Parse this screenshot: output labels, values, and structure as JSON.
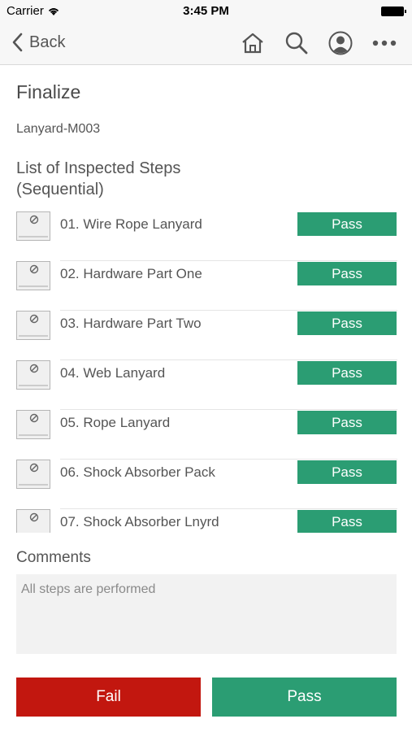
{
  "status": {
    "carrier": "Carrier",
    "time": "3:45 PM"
  },
  "nav": {
    "back_label": "Back",
    "icons": [
      "home-icon",
      "search-icon",
      "profile-icon",
      "more-icon"
    ]
  },
  "page": {
    "title": "Finalize",
    "asset": "Lanyard-M003",
    "list_title_line1": "List of Inspected Steps",
    "list_title_line2": "(Sequential)"
  },
  "steps": [
    {
      "name": "01. Wire Rope Lanyard",
      "result": "Pass"
    },
    {
      "name": "02. Hardware Part One",
      "result": "Pass"
    },
    {
      "name": "03. Hardware Part Two",
      "result": "Pass"
    },
    {
      "name": "04. Web Lanyard",
      "result": "Pass"
    },
    {
      "name": "05. Rope Lanyard",
      "result": "Pass"
    },
    {
      "name": "06. Shock Absorber Pack",
      "result": "Pass"
    },
    {
      "name": "07. Shock Absorber Lnyrd",
      "result": "Pass"
    }
  ],
  "comments": {
    "label": "Comments",
    "placeholder": "All steps are performed"
  },
  "actions": {
    "fail_label": "Fail",
    "pass_label": "Pass"
  },
  "colors": {
    "pass": "#2b9d73",
    "fail": "#c2170f"
  }
}
